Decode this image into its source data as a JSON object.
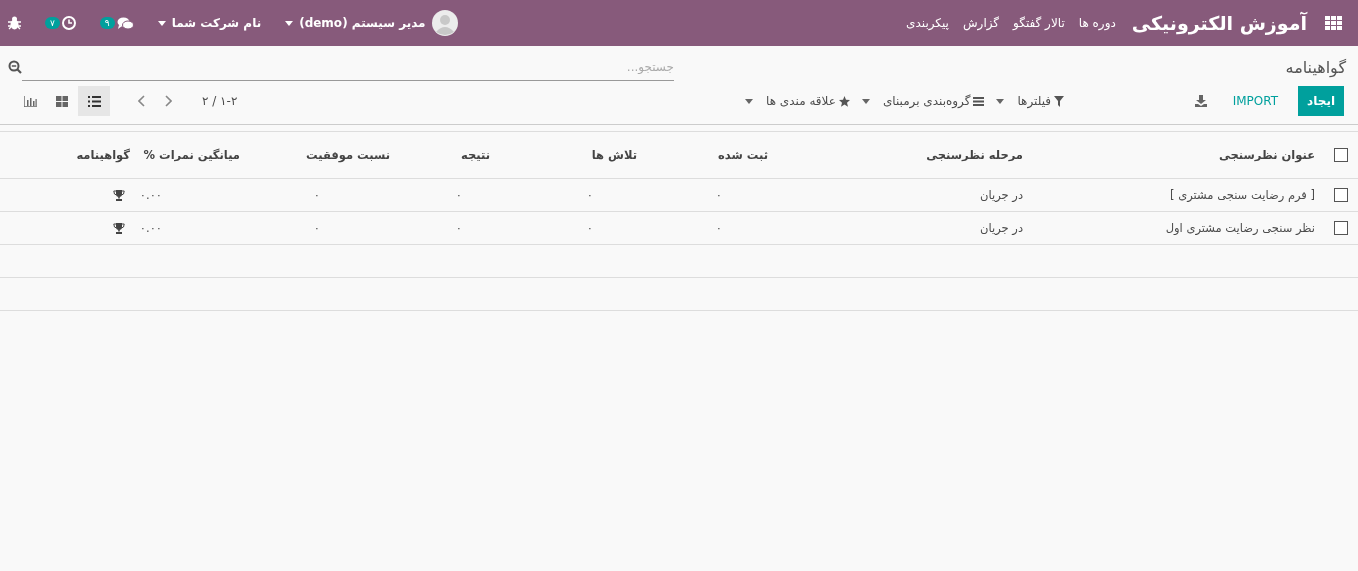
{
  "navbar": {
    "app_title": "آموزش الکترونیکی",
    "menu": [
      "دوره ها",
      "تالار گفتگو",
      "گزارش",
      "پیکربندی"
    ],
    "activity_count": "۷",
    "message_count": "۹",
    "company": "نام شرکت شما",
    "user": "مدیر سیستم (demo)"
  },
  "breadcrumb": "گواهینامه",
  "search": {
    "placeholder": "جستجو..."
  },
  "buttons": {
    "create": "ایجاد",
    "import": "IMPORT"
  },
  "search_options": [
    {
      "label": "فیلترها",
      "kind": "filter"
    },
    {
      "label": "گروه‌بندی برمبنای",
      "kind": "group"
    },
    {
      "label": "علاقه مندی ها",
      "kind": "favorite"
    }
  ],
  "pager": "۲ / ۱-۲",
  "views": [
    {
      "kind": "list",
      "selected": true
    },
    {
      "kind": "kanban",
      "selected": false
    },
    {
      "kind": "graph",
      "selected": false
    }
  ],
  "table": {
    "all_checked": false,
    "columns": [
      "عنوان نظرسنجی",
      "مرحله نظرسنجی",
      "ثبت شده",
      "تلاش ها",
      "نتیجه",
      "نسبت موفقیت",
      "میانگین نمرات %",
      "گواهینامه"
    ],
    "rows": [
      {
        "checked": false,
        "cells": [
          "[ فرم رضایت سنجی مشتری ]",
          "در جریان",
          "۰",
          "۰",
          "۰",
          "۰",
          "۰.۰۰"
        ],
        "certificate": true
      },
      {
        "checked": false,
        "cells": [
          "نظر سنجی رضایت مشتری اول",
          "در جریان",
          "۰",
          "۰",
          "۰",
          "۰",
          "۰.۰۰"
        ],
        "certificate": true
      }
    ]
  }
}
